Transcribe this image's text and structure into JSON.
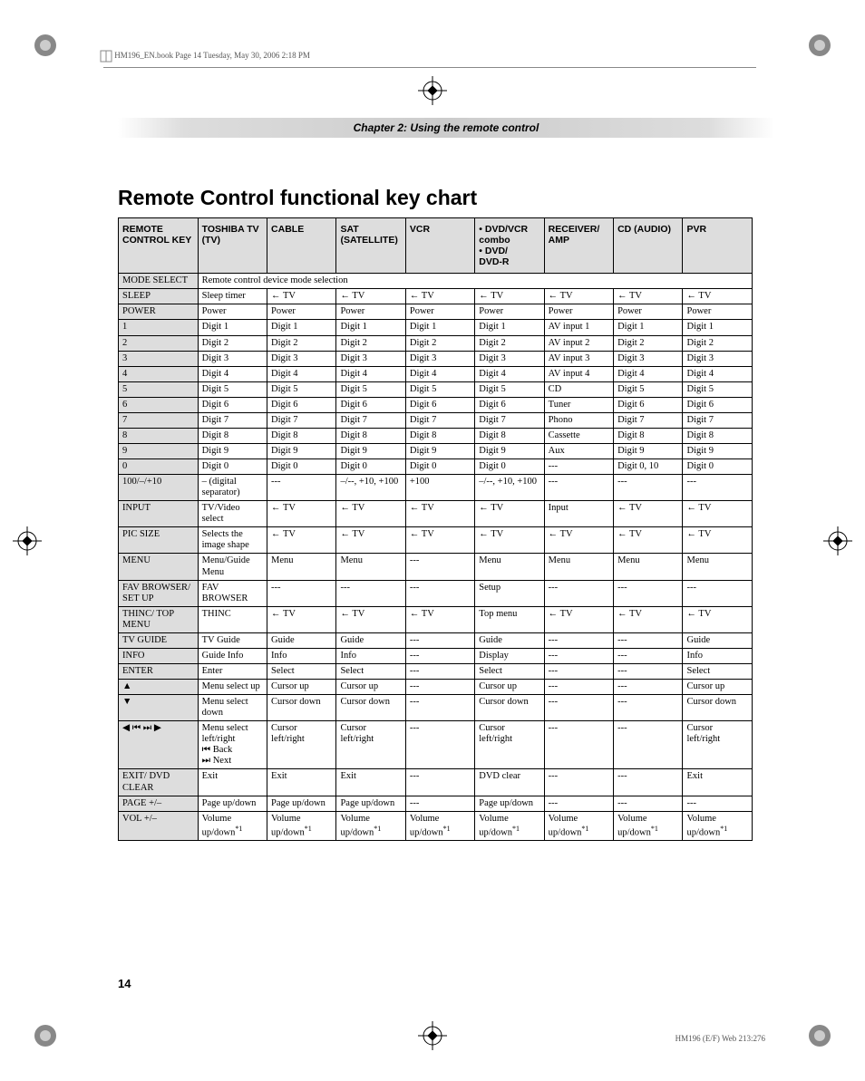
{
  "running_header": "HM196_EN.book  Page 14  Tuesday, May 30, 2006  2:18 PM",
  "chapter_bar": "Chapter 2: Using the remote control",
  "main_title": "Remote Control functional key chart",
  "headers": [
    "Remote Control Key",
    "Toshiba TV (TV)",
    "Cable",
    "SAT (Satellite)",
    "VCR",
    "• DVD/VCR combo\n• DVD/\nDVD-R",
    "Receiver/ AMP",
    "CD (Audio)",
    "PVR"
  ],
  "mode_row": {
    "key": "MODE SELECT",
    "text": "Remote control device mode selection"
  },
  "rows": [
    {
      "key": "SLEEP",
      "cells": [
        "Sleep timer",
        "← TV",
        "← TV",
        "← TV",
        "← TV",
        "← TV",
        "← TV",
        "← TV"
      ]
    },
    {
      "key": "POWER",
      "cells": [
        "Power",
        "Power",
        "Power",
        "Power",
        "Power",
        "Power",
        "Power",
        "Power"
      ]
    },
    {
      "key": "1",
      "cells": [
        "Digit 1",
        "Digit 1",
        "Digit 1",
        "Digit 1",
        "Digit 1",
        "AV input 1",
        "Digit 1",
        "Digit 1"
      ]
    },
    {
      "key": "2",
      "cells": [
        "Digit 2",
        "Digit 2",
        "Digit 2",
        "Digit 2",
        "Digit 2",
        "AV input 2",
        "Digit 2",
        "Digit 2"
      ]
    },
    {
      "key": "3",
      "cells": [
        "Digit 3",
        "Digit 3",
        "Digit 3",
        "Digit 3",
        "Digit 3",
        "AV input 3",
        "Digit 3",
        "Digit 3"
      ]
    },
    {
      "key": "4",
      "cells": [
        "Digit 4",
        "Digit 4",
        "Digit 4",
        "Digit 4",
        "Digit 4",
        "AV input 4",
        "Digit 4",
        "Digit 4"
      ]
    },
    {
      "key": "5",
      "cells": [
        "Digit 5",
        "Digit 5",
        "Digit 5",
        "Digit 5",
        "Digit 5",
        "CD",
        "Digit 5",
        "Digit 5"
      ]
    },
    {
      "key": "6",
      "cells": [
        "Digit 6",
        "Digit 6",
        "Digit 6",
        "Digit 6",
        "Digit 6",
        "Tuner",
        "Digit 6",
        "Digit 6"
      ]
    },
    {
      "key": "7",
      "cells": [
        "Digit 7",
        "Digit 7",
        "Digit 7",
        "Digit 7",
        "Digit 7",
        "Phono",
        "Digit 7",
        "Digit 7"
      ]
    },
    {
      "key": "8",
      "cells": [
        "Digit 8",
        "Digit 8",
        "Digit 8",
        "Digit 8",
        "Digit 8",
        "Cassette",
        "Digit 8",
        "Digit 8"
      ]
    },
    {
      "key": "9",
      "cells": [
        "Digit 9",
        "Digit 9",
        "Digit 9",
        "Digit 9",
        "Digit 9",
        "Aux",
        "Digit 9",
        "Digit 9"
      ]
    },
    {
      "key": "0",
      "cells": [
        "Digit 0",
        "Digit 0",
        "Digit 0",
        "Digit 0",
        "Digit 0",
        "---",
        "Digit 0, 10",
        "Digit 0"
      ]
    },
    {
      "key": "100/–/+10",
      "cells": [
        "– (digital separator)",
        "---",
        "–/--, +10, +100",
        "+100",
        "–/--, +10, +100",
        "---",
        "---",
        "---"
      ]
    },
    {
      "key": "INPUT",
      "cells": [
        "TV/Video select",
        "← TV",
        "← TV",
        "← TV",
        "← TV",
        "Input",
        "← TV",
        "← TV"
      ]
    },
    {
      "key": "PIC SIZE",
      "cells": [
        "Selects the image shape",
        "← TV",
        "← TV",
        "← TV",
        "← TV",
        "← TV",
        "← TV",
        "← TV"
      ]
    },
    {
      "key": "MENU",
      "cells": [
        "Menu/Guide Menu",
        "Menu",
        "Menu",
        "---",
        "Menu",
        "Menu",
        "Menu",
        "Menu"
      ]
    },
    {
      "key": "FAV BROWSER/ SET UP",
      "cells": [
        "FAV BROWSER",
        "---",
        "---",
        "---",
        "Setup",
        "---",
        "---",
        "---"
      ]
    },
    {
      "key": "THINC/ TOP MENU",
      "cells": [
        "THINC",
        "← TV",
        "← TV",
        "← TV",
        "Top menu",
        "← TV",
        "← TV",
        "← TV"
      ]
    },
    {
      "key": "TV GUIDE",
      "cells": [
        "TV Guide",
        "Guide",
        "Guide",
        "---",
        "Guide",
        "---",
        "---",
        "Guide"
      ]
    },
    {
      "key": "INFO",
      "cells": [
        "Guide Info",
        "Info",
        "Info",
        "---",
        "Display",
        "---",
        "---",
        "Info"
      ]
    },
    {
      "key": "ENTER",
      "cells": [
        "Enter",
        "Select",
        "Select",
        "---",
        "Select",
        "---",
        "---",
        "Select"
      ]
    },
    {
      "key": "▲",
      "cells": [
        "Menu select up",
        "Cursor up",
        "Cursor up",
        "---",
        "Cursor up",
        "---",
        "---",
        "Cursor up"
      ]
    },
    {
      "key": "▼",
      "cells": [
        "Menu select down",
        "Cursor down",
        "Cursor down",
        "---",
        "Cursor down",
        "---",
        "---",
        "Cursor down"
      ]
    },
    {
      "key": "◀ ⏮ ⏭ ▶",
      "cells": [
        "Menu select left/right\n⏮ Back\n⏭ Next",
        "Cursor left/right",
        "Cursor left/right",
        "---",
        "Cursor left/right",
        "---",
        "---",
        "Cursor left/right"
      ]
    },
    {
      "key": "EXIT/ DVD CLEAR",
      "cells": [
        "Exit",
        "Exit",
        "Exit",
        "---",
        "DVD clear",
        "---",
        "---",
        "Exit"
      ]
    },
    {
      "key": "PAGE +/–",
      "cells": [
        "Page up/down",
        "Page up/down",
        "Page up/down",
        "---",
        "Page up/down",
        "---",
        "---",
        "---"
      ]
    },
    {
      "key": "VOL +/–",
      "cells": [
        "Volume up/down*1",
        "Volume up/down*1",
        "Volume up/down*1",
        "Volume up/down*1",
        "Volume up/down*1",
        "Volume up/down*1",
        "Volume up/down*1",
        "Volume up/down*1"
      ]
    }
  ],
  "page_number": "14",
  "footer_right": "HM196 (E/F) Web 213:276"
}
